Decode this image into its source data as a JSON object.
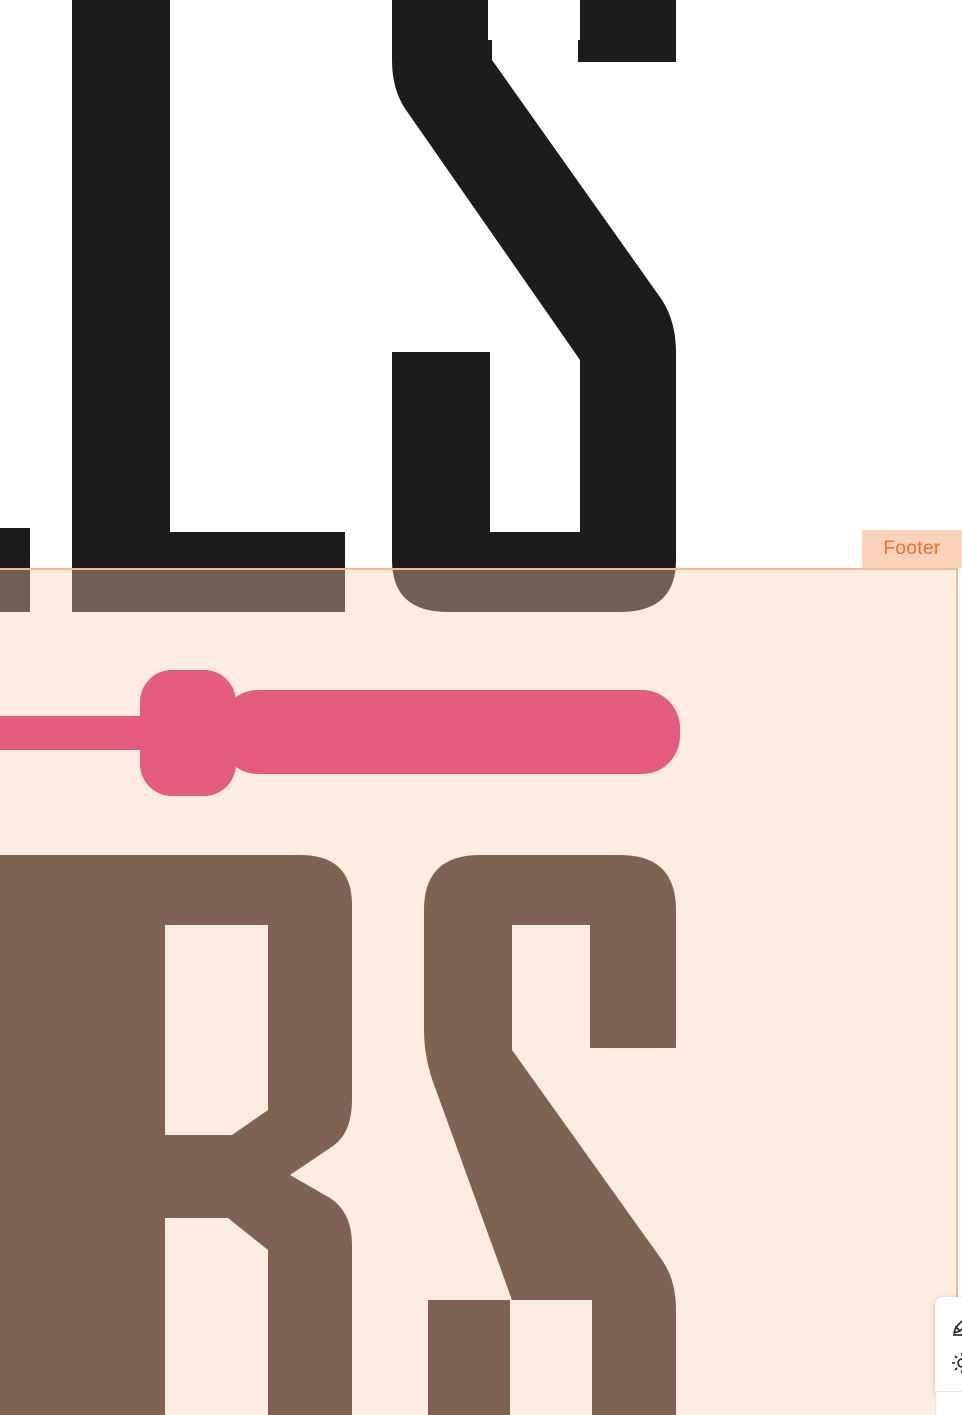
{
  "footer": {
    "label": "Footer"
  },
  "toolbar": {
    "items": [
      {
        "name": "edit",
        "icon": "pen-icon"
      },
      {
        "name": "settings",
        "icon": "gear-icon"
      }
    ]
  },
  "colors": {
    "logo_black": "#1c1c1c",
    "logo_brown": "#33221b",
    "barbell_pink": "#d6155e",
    "footer_accent": "#f26b2a",
    "footer_border": "#f8b896",
    "footer_tag_bg": "#fdd2bb"
  }
}
